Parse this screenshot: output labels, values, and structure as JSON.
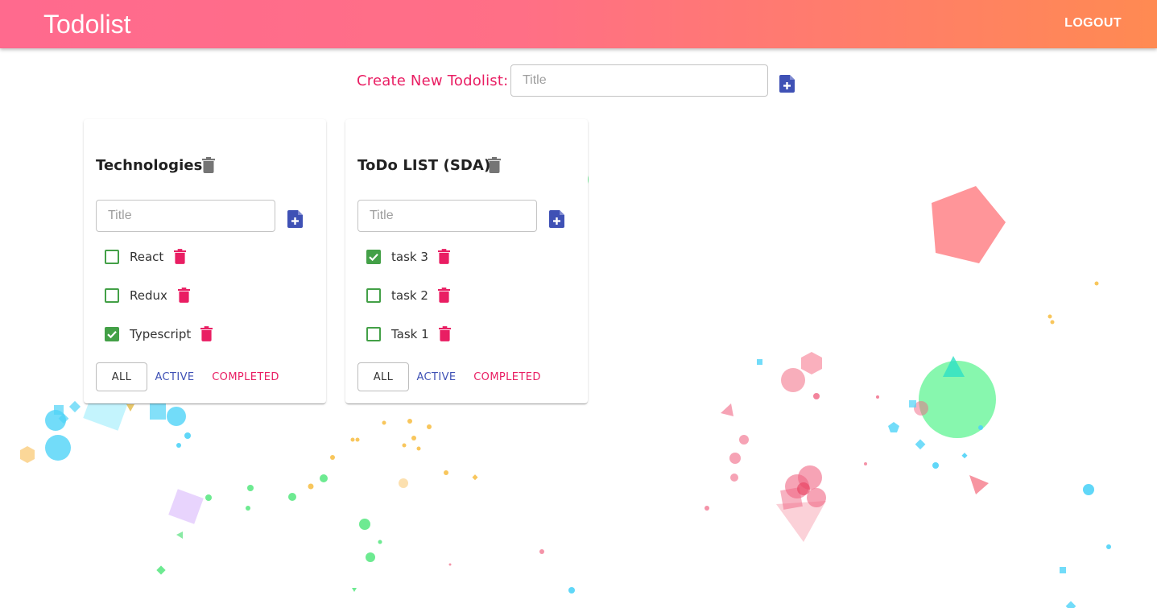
{
  "header": {
    "app_title": "Todolist",
    "logout_label": "LOGOUT",
    "gradient_start": "#ff6a8e",
    "gradient_end": "#ff8a52"
  },
  "create": {
    "label": "Create New Todolist:",
    "placeholder": "Title",
    "value": "",
    "add_icon": "note-add-icon"
  },
  "colors": {
    "accent_pink": "#e91e63",
    "primary_blue": "#3f51b5",
    "check_green": "#43a047",
    "delete_grey": "#757575"
  },
  "todolists": [
    {
      "title": "Technologies",
      "input_placeholder": "Title",
      "tasks": [
        {
          "label": "React",
          "done": false
        },
        {
          "label": "Redux",
          "done": false
        },
        {
          "label": "Typescript",
          "done": true
        }
      ],
      "filters": {
        "all": "ALL",
        "active": "ACTIVE",
        "completed": "COMPLETED"
      },
      "selected_filter": "ALL"
    },
    {
      "title": "ToDo LIST (SDA)",
      "input_placeholder": "Title",
      "tasks": [
        {
          "label": "task 3",
          "done": true
        },
        {
          "label": "task 2",
          "done": false
        },
        {
          "label": "Task 1",
          "done": false
        }
      ],
      "filters": {
        "all": "ALL",
        "active": "ACTIVE",
        "completed": "COMPLETED"
      },
      "selected_filter": "ALL"
    }
  ]
}
